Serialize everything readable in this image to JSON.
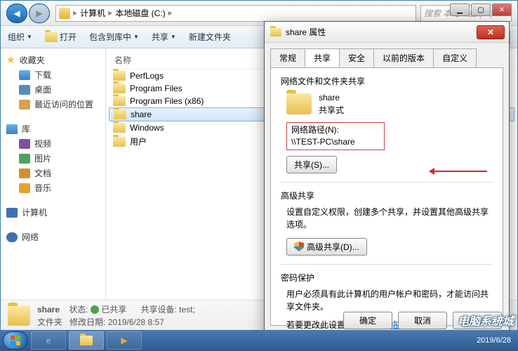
{
  "window_controls": {
    "min": "▁",
    "max": "▢",
    "close": "✕"
  },
  "breadcrumb": {
    "root": "计算机",
    "drive": "本地磁盘 (C:)"
  },
  "search": {
    "placeholder": "搜索 本地磁盘 (C:)"
  },
  "toolbar": {
    "organize": "组织",
    "open": "打开",
    "include": "包含到库中",
    "share": "共享",
    "newfolder": "新建文件夹"
  },
  "sidebar": {
    "fav": "收藏夹",
    "items_fav": [
      "下载",
      "桌面",
      "最近访问的位置"
    ],
    "lib": "库",
    "items_lib": [
      "视频",
      "图片",
      "文档",
      "音乐"
    ],
    "computer": "计算机",
    "network": "网络"
  },
  "filepane": {
    "col_name": "名称",
    "files": [
      "PerfLogs",
      "Program Files",
      "Program Files (x86)",
      "share",
      "Windows",
      "用户"
    ],
    "selected_index": 3
  },
  "details": {
    "name": "share",
    "state_label": "状态:",
    "state_value": "已共享",
    "type_label": "文件夹",
    "date_label": "修改日期:",
    "date_value": "2019/6/28 8:57",
    "device_label": "共享设备:",
    "device_value": "test;"
  },
  "dialog": {
    "title": "share 属性",
    "tabs": [
      "常规",
      "共享",
      "安全",
      "以前的版本",
      "自定义"
    ],
    "active_tab": 1,
    "section1_label": "网络文件和文件夹共享",
    "share_name": "share",
    "share_mode": "共享式",
    "netpath_label": "网络路径(N):",
    "netpath_value": "\\\\TEST-PC\\share",
    "share_btn": "共享(S)...",
    "adv_label": "高级共享",
    "adv_desc": "设置自定义权限，创建多个共享，并设置其他高级共享选项。",
    "adv_btn": "高级共享(D)...",
    "pw_label": "密码保护",
    "pw_desc": "用户必须具有此计算机的用户帐户和密码，才能访问共享文件夹。",
    "pw_change_prefix": "若要更改此设置，请使用",
    "pw_link": "网络和共享中心",
    "ok": "确定",
    "cancel": "取消",
    "apply": "应用(A)"
  },
  "taskbar": {
    "time": "2019/6/28"
  },
  "watermark": "电脑系统城"
}
